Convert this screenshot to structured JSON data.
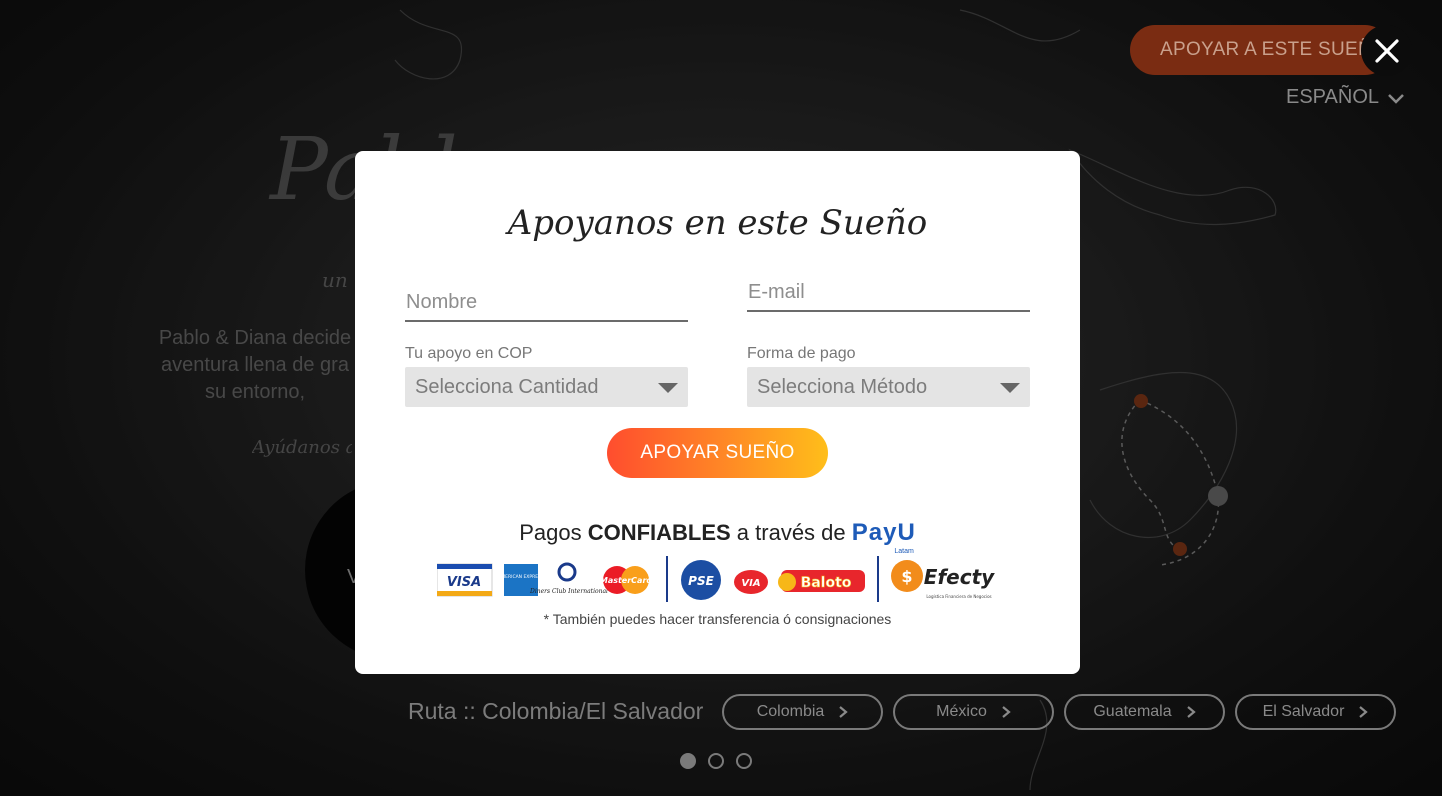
{
  "header": {
    "support_button": "APOYAR A ESTE SUEÑO",
    "language": "ESPAÑOL"
  },
  "background": {
    "title_script": "Pablo y",
    "subtitle_script": "un",
    "paragraph": [
      "Pablo & Diana decide",
      "aventura llena de gra",
      "su entorno,"
    ],
    "help_text": "Ayúdanos a",
    "circle_text": "V",
    "route_label": "Ruta :: Colombia/El Salvador",
    "countries": [
      "Colombia",
      "México",
      "Guatemala",
      "El Salvador"
    ]
  },
  "modal": {
    "title": "Apoyanos en este Sueño",
    "name_placeholder": "Nombre",
    "email_placeholder": "E-mail",
    "amount_label": "Tu apoyo en COP",
    "amount_select": "Selecciona Cantidad",
    "method_label": "Forma de pago",
    "method_select": "Selecciona Método",
    "submit_label": "APOYAR SUEÑO",
    "payments_prefix": "Pagos ",
    "payments_bold": "CONFIABLES",
    "payments_suffix": " a través de ",
    "payu_brand": "PayU",
    "payu_sub": "Latam",
    "logos": {
      "visa": "VISA",
      "amex": "AMERICAN EXPRESS",
      "diners": "Diners Club International",
      "mastercard": "MasterCard",
      "pse": "PSE",
      "via": "VIA",
      "baloto": "Baloto",
      "efecty": "Efecty",
      "efecty_sub": "Logística Financiera de Negocios"
    },
    "note": "* También puedes hacer transferencia ó consignaciones"
  },
  "carousel": {
    "total": 3,
    "active": 1
  },
  "colors": {
    "accent": "#ff6a2b",
    "modal_bg": "#ffffff",
    "payu": "#1e5bb8"
  }
}
